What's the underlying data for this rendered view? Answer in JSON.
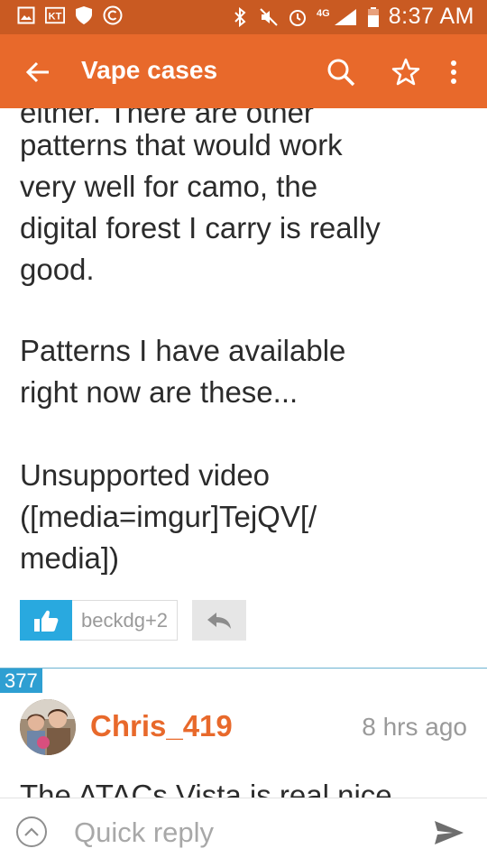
{
  "status_bar": {
    "time": "8:37 AM",
    "network": "4G",
    "left_icons": [
      "gallery-icon",
      "kt-icon",
      "shield-icon",
      "copyright-icon"
    ],
    "right_icons": [
      "bluetooth-icon",
      "mute-icon",
      "alarm-icon",
      "signal-icon",
      "battery-icon"
    ]
  },
  "app_bar": {
    "title": "Vape cases",
    "icons": [
      "back-arrow-icon",
      "search-icon",
      "star-icon",
      "more-vert-icon"
    ]
  },
  "post": {
    "partial_top_line": "either. There are other",
    "paragraph1": [
      "patterns that would work",
      "very well for camo, the",
      "digital forest I carry is really",
      "good."
    ],
    "paragraph2": [
      "Patterns I have available",
      "right now are these..."
    ],
    "paragraph3": [
      "Unsupported video",
      "([media=imgur]TejQV[/",
      "media])"
    ],
    "likers": "beckdg+2"
  },
  "next_post": {
    "number": "377",
    "username": "Chris_419",
    "timestamp": "8 hrs ago",
    "partial_text": "The ATACs Vista is real nice"
  },
  "quick_reply": {
    "placeholder": "Quick reply"
  },
  "colors": {
    "status_bar": "#c95a22",
    "app_bar": "#e8692b",
    "like_button": "#29a9df",
    "post_number_badge": "#2e9fd2",
    "username": "#e8692b"
  }
}
